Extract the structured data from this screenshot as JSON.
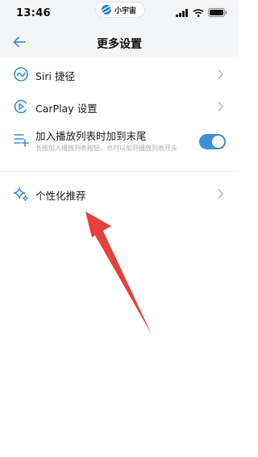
{
  "status": {
    "time": "13:46",
    "app_name": "小宇宙"
  },
  "nav": {
    "title": "更多设置",
    "back_icon": "back-arrow-icon"
  },
  "settings": {
    "siri_label": "Siri 捷径",
    "carplay_label": "CarPlay 设置",
    "queue": {
      "label": "加入播放列表时加到末尾",
      "description": "长按加入播放列表按钮，也可以加到播放列表开头",
      "enabled": true
    },
    "personalize_label": "个性化推荐"
  },
  "colors": {
    "accent": "#3f8fd8",
    "icon": "#3f8fd8",
    "arrow": "#e8403a"
  }
}
